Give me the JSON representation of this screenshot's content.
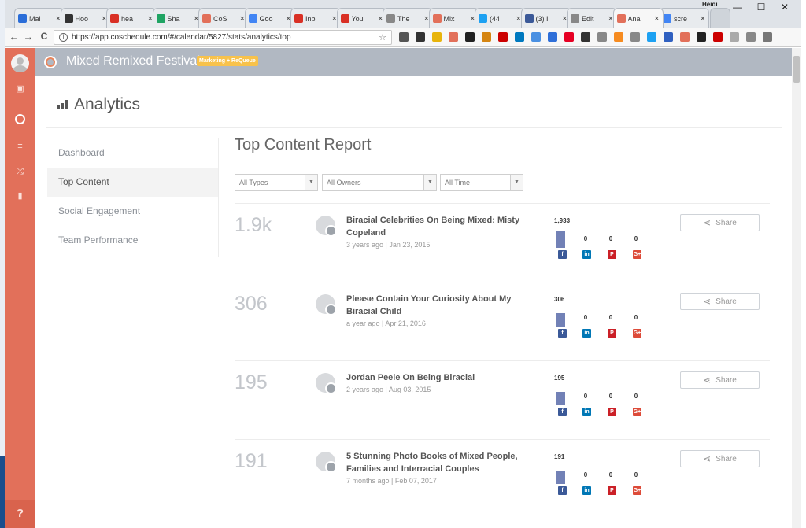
{
  "browser": {
    "tabs": [
      {
        "label": "Mai",
        "color": "#2a6dd8",
        "active": false
      },
      {
        "label": "Hoo",
        "color": "#333333",
        "active": false
      },
      {
        "label": "hea",
        "color": "#d93025",
        "active": false
      },
      {
        "label": "Sha",
        "color": "#1fa463",
        "active": false
      },
      {
        "label": "CoS",
        "color": "#e2705a",
        "active": false
      },
      {
        "label": "Goo",
        "color": "#4285f4",
        "active": false
      },
      {
        "label": "Inb",
        "color": "#d93025",
        "active": false
      },
      {
        "label": "You",
        "color": "#d93025",
        "active": false
      },
      {
        "label": "The",
        "color": "#888888",
        "active": false
      },
      {
        "label": "Mix",
        "color": "#e2705a",
        "active": false
      },
      {
        "label": "(44",
        "color": "#1da1f2",
        "active": false
      },
      {
        "label": "(3) I",
        "color": "#3b5998",
        "active": false
      },
      {
        "label": "Edit",
        "color": "#888888",
        "active": false
      },
      {
        "label": "Ana",
        "color": "#e2705a",
        "active": true
      },
      {
        "label": "scre",
        "color": "#4285f4",
        "active": false
      }
    ],
    "tab_close": "×",
    "user": "Heidi",
    "window_controls": {
      "minimize": "—",
      "maximize": "☐",
      "close": "✕"
    },
    "nav": {
      "back": "←",
      "forward": "→",
      "reload": "C"
    },
    "url": "https://app.coschedule.com/#/calendar/5827/stats/analytics/top",
    "info_glyph": "i",
    "star_glyph": "☆"
  },
  "app": {
    "calendar_name": "Mixed Remixed Festival",
    "calendar_tag": "Marketing + ReQueue",
    "help_label": "?",
    "page_title": "Analytics",
    "menu": [
      {
        "label": "Dashboard",
        "active": false
      },
      {
        "label": "Top Content",
        "active": true
      },
      {
        "label": "Social Engagement",
        "active": false
      },
      {
        "label": "Team Performance",
        "active": false
      }
    ],
    "report": {
      "title": "Top Content Report",
      "filters": [
        {
          "value": "All Types"
        },
        {
          "value": "All Owners"
        },
        {
          "value": "All Time"
        }
      ],
      "filter_arrow": "▼",
      "share_label": "Share",
      "social_glyphs": {
        "facebook": "f",
        "linkedin": "in",
        "pinterest": "P",
        "googleplus": "G+"
      },
      "rows": [
        {
          "count": "1.9k",
          "title": "Biracial Celebrities On Being Mixed: Misty Copeland",
          "meta": "3 years ago | Jan 23, 2015",
          "facebook": "1,933",
          "facebook_value": 1933,
          "linkedin": "0",
          "pinterest": "0",
          "googleplus": "0"
        },
        {
          "count": "306",
          "title": "Please Contain Your Curiosity About My Biracial Child",
          "meta": "a year ago | Apr 21, 2016",
          "facebook": "306",
          "facebook_value": 306,
          "linkedin": "0",
          "pinterest": "0",
          "googleplus": "0"
        },
        {
          "count": "195",
          "title": "Jordan Peele On Being Biracial",
          "meta": "2 years ago | Aug 03, 2015",
          "facebook": "195",
          "facebook_value": 195,
          "linkedin": "0",
          "pinterest": "0",
          "googleplus": "0"
        },
        {
          "count": "191",
          "title": "5 Stunning Photo Books of Mixed People, Families and Interracial Couples",
          "meta": "7 months ago | Feb 07, 2017",
          "facebook": "191",
          "facebook_value": 191,
          "linkedin": "0",
          "pinterest": "0",
          "googleplus": "0"
        }
      ]
    }
  }
}
